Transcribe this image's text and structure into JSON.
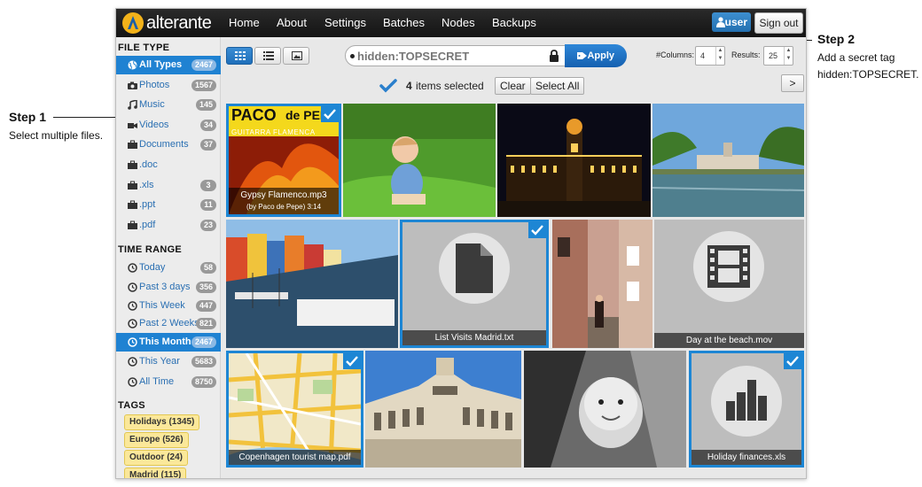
{
  "annotations": {
    "step1": {
      "title": "Step 1",
      "text": "Select multiple files."
    },
    "step2": {
      "title": "Step 2",
      "line1": "Add a secret tag",
      "line2": "hidden:TOPSECRET."
    }
  },
  "app": {
    "brand": "alterante",
    "nav": [
      "Home",
      "About",
      "Settings",
      "Batches",
      "Nodes",
      "Backups"
    ],
    "user_label": "user",
    "signout_label": "Sign out"
  },
  "sidebar": {
    "file_type_title": "FILE TYPE",
    "file_types": [
      {
        "label": "All Types",
        "count": "2467",
        "icon": "globe-icon",
        "active": true
      },
      {
        "label": "Photos",
        "count": "1567",
        "icon": "camera-icon"
      },
      {
        "label": "Music",
        "count": "145",
        "icon": "music-note-icon"
      },
      {
        "label": "Videos",
        "count": "34",
        "icon": "video-camera-icon"
      },
      {
        "label": "Documents",
        "count": "37",
        "icon": "briefcase-icon"
      },
      {
        "label": ".doc",
        "count": "",
        "icon": "briefcase-icon"
      },
      {
        "label": ".xls",
        "count": "3",
        "icon": "briefcase-icon"
      },
      {
        "label": ".ppt",
        "count": "11",
        "icon": "briefcase-icon"
      },
      {
        "label": ".pdf",
        "count": "23",
        "icon": "briefcase-icon"
      }
    ],
    "time_range_title": "TIME RANGE",
    "time_ranges": [
      {
        "label": "Today",
        "count": "58"
      },
      {
        "label": "Past 3 days",
        "count": "356"
      },
      {
        "label": "This Week",
        "count": "447"
      },
      {
        "label": "Past 2 Weeks",
        "count": "821"
      },
      {
        "label": "This Month",
        "count": "2467",
        "active": true
      },
      {
        "label": "This Year",
        "count": "5683"
      },
      {
        "label": "All Time",
        "count": "8750"
      }
    ],
    "tags_title": "TAGS",
    "tags": [
      "Holidays (1345)",
      "Europe (526)",
      "Outdoor (24)",
      "Madrid (115)"
    ]
  },
  "toolbar": {
    "search_value": "hidden:TOPSECRET",
    "apply_label": "Apply",
    "columns_label": "#Columns:",
    "columns_value": "4",
    "results_label": "Results:",
    "results_value": "25",
    "selected_count": "4",
    "selected_text": "items selected",
    "clear_label": "Clear",
    "select_all_label": "Select All",
    "next_label": ">"
  },
  "tiles": {
    "album_line1": "PACO",
    "album_line2": "de PEPE",
    "album_subtitle": "GUITARRA FLAMENCA",
    "flamenco_caption": "Gypsy Flamenco.mp3",
    "flamenco_caption2": "(by Paco de Pepe) 3:14",
    "txt_caption": "List Visits Madrid.txt",
    "mov_caption": "Day at the beach.mov",
    "map_caption": "Copenhagen tourist map.pdf",
    "xls_caption": "Holiday finances.xls"
  },
  "colors": {
    "accent": "#1d86d4",
    "tag_bg": "#fbe89a",
    "topbar": "#1b1b1b"
  }
}
